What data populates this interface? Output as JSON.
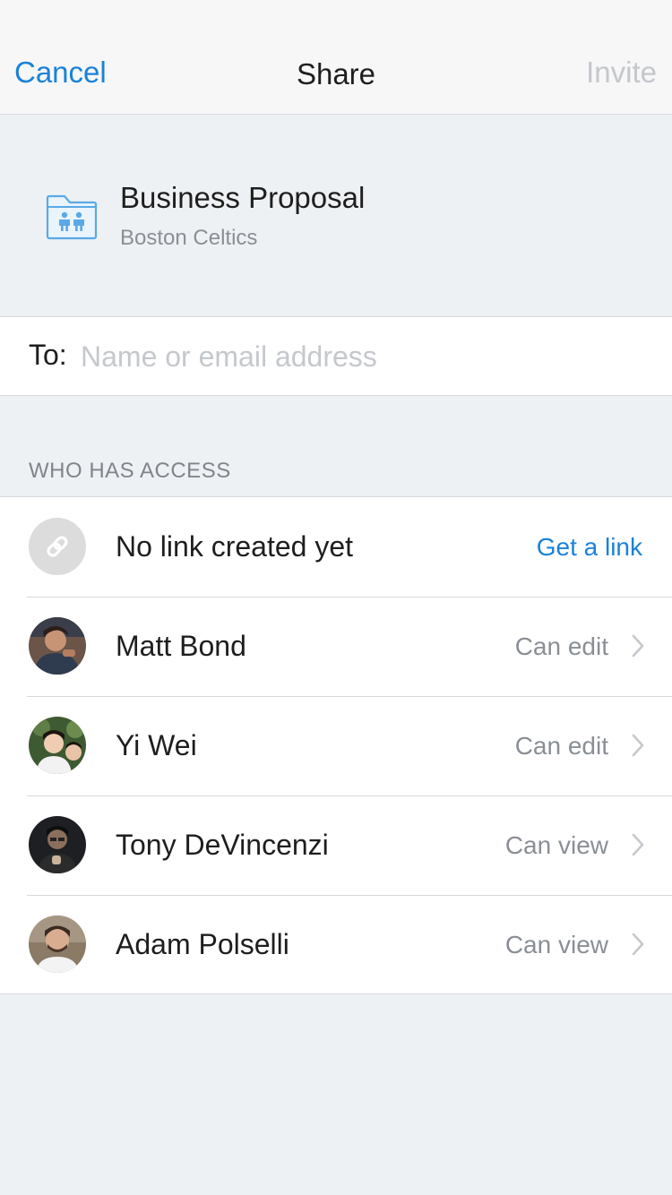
{
  "nav": {
    "cancel": "Cancel",
    "title": "Share",
    "invite": "Invite"
  },
  "folder": {
    "name": "Business Proposal",
    "team": "Boston Celtics",
    "icon": "shared-folder-icon"
  },
  "to": {
    "label": "To:",
    "placeholder": "Name or email address",
    "value": ""
  },
  "access": {
    "header": "WHO HAS ACCESS",
    "link_row": {
      "label": "No link created yet",
      "action": "Get a link",
      "icon": "link-icon"
    },
    "members": [
      {
        "name": "Matt Bond",
        "permission": "Can edit"
      },
      {
        "name": "Yi Wei",
        "permission": "Can edit"
      },
      {
        "name": "Tony DeVincenzi",
        "permission": "Can view"
      },
      {
        "name": "Adam Polselli",
        "permission": "Can view"
      }
    ]
  },
  "colors": {
    "accent": "#1a82d8",
    "disabled": "#c4c7cb",
    "background": "#eef1f4"
  }
}
